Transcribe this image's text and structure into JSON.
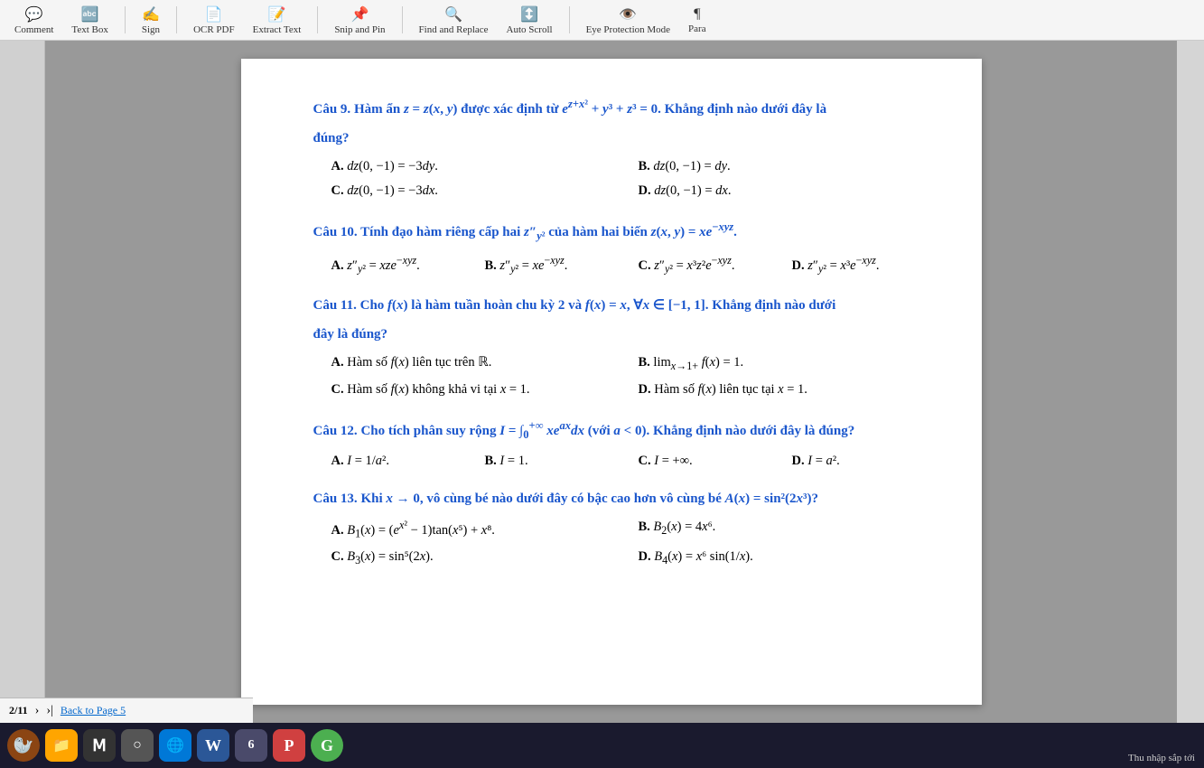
{
  "toolbar": {
    "items": [
      {
        "label": "Comment",
        "icon": "💬"
      },
      {
        "label": "Text Box",
        "icon": "🔤"
      },
      {
        "label": "Sign",
        "icon": "✍️"
      },
      {
        "label": "OCR PDF",
        "icon": "📄"
      },
      {
        "label": "Extract Text",
        "icon": "📝"
      },
      {
        "label": "Snip and Pin",
        "icon": "📌"
      },
      {
        "label": "Find and Replace",
        "icon": "🔍"
      },
      {
        "label": "Auto Scroll",
        "icon": "↕️"
      },
      {
        "label": "Eye Protection Mode",
        "icon": "👁️"
      },
      {
        "label": "Para",
        "icon": "¶"
      }
    ]
  },
  "page": {
    "number": "2/11",
    "back_label": "Back to Page 5",
    "questions": [
      {
        "id": "q9",
        "number": "Câu 9.",
        "text": "Hàm ẩn z = z(x, y) được xác định từ e^{z+x²} + y³ + z³ = 0. Khẳng định nào dưới đây là đúng?",
        "answers": [
          {
            "label": "A.",
            "text": "dz(0, −1) = −3dy."
          },
          {
            "label": "B.",
            "text": "dz(0, −1) = dy."
          },
          {
            "label": "C.",
            "text": "dz(0, −1) = −3dx."
          },
          {
            "label": "D.",
            "text": "dz(0, −1) = dx."
          }
        ]
      },
      {
        "id": "q10",
        "number": "Câu 10.",
        "text": "Tính đạo hàm riêng cấp hai z″_{y²} của hàm hai biến z(x, y) = xe^{−xyz}.",
        "answers": [
          {
            "label": "A.",
            "text": "z″_{y²} = xze^{−xyz}."
          },
          {
            "label": "B.",
            "text": "z″_{y²} = xe^{−xyz}."
          },
          {
            "label": "C.",
            "text": "z″_{y²} = x³z²e^{−xyz}."
          },
          {
            "label": "D.",
            "text": "z″_{y²} = x³e^{−xyz}."
          }
        ]
      },
      {
        "id": "q11",
        "number": "Câu 11.",
        "text": "Cho f(x) là hàm tuần hoàn chu kỳ 2 và f(x) = x, ∀x ∈ [−1, 1]. Khẳng định nào dưới đây là đúng?",
        "answers": [
          {
            "label": "A.",
            "text": "Hàm số f(x) liên tục trên ℝ."
          },
          {
            "label": "B.",
            "text": "lim_{x→1+} f(x) = 1."
          },
          {
            "label": "C.",
            "text": "Hàm số f(x) không khả vi tại x = 1."
          },
          {
            "label": "D.",
            "text": "Hàm số f(x) liên tục tại x = 1."
          }
        ]
      },
      {
        "id": "q12",
        "number": "Câu 12.",
        "text": "Cho tích phân suy rộng I = ∫₀^{+∞} xe^{ax}dx (với a < 0). Khẳng định nào dưới đây là đúng?",
        "answers": [
          {
            "label": "A.",
            "text": "I = 1/a²."
          },
          {
            "label": "B.",
            "text": "I = 1."
          },
          {
            "label": "C.",
            "text": "I = +∞."
          },
          {
            "label": "D.",
            "text": "I = a²."
          }
        ]
      },
      {
        "id": "q13",
        "number": "Câu 13.",
        "text": "Khi x → 0, vô cùng bé nào dưới đây có bậc cao hơn vô cùng bé A(x) = sin²(2x³)?",
        "answers": [
          {
            "label": "A.",
            "text": "B₁(x) = (e^{x²} − 1)tan(x⁵) + x⁸."
          },
          {
            "label": "B.",
            "text": "B₂(x) = 4x⁶."
          },
          {
            "label": "C.",
            "text": "B₃(x) = sin⁵(2x)."
          },
          {
            "label": "D.",
            "text": "B₄(x) = x⁶ sin(1/x)."
          }
        ]
      }
    ]
  },
  "taskbar": {
    "apps": [
      {
        "name": "seal-mascot",
        "color": "#8B4513",
        "icon": "🦭"
      },
      {
        "name": "file-manager",
        "color": "#FFA500",
        "icon": "📁"
      },
      {
        "name": "text-editor",
        "color": "#333",
        "icon": "Ⅿ"
      },
      {
        "name": "search",
        "color": "#fff",
        "icon": "○"
      },
      {
        "name": "edge-browser",
        "color": "#0078d7",
        "icon": "🌐"
      },
      {
        "name": "word-app",
        "color": "#2b5797",
        "icon": "W"
      },
      {
        "name": "app-651",
        "color": "#3c3c3c",
        "icon": "6"
      },
      {
        "name": "pdf-app",
        "color": "#d04040",
        "icon": "P"
      },
      {
        "name": "chrome",
        "color": "#4CAF50",
        "icon": "G"
      }
    ],
    "sys_tray": "Thu nhập sắp tới"
  },
  "nav": {
    "page_label": "2/11",
    "prev_icon": ">",
    "next_icon": ">|",
    "back_label": "Back to Page 5"
  }
}
